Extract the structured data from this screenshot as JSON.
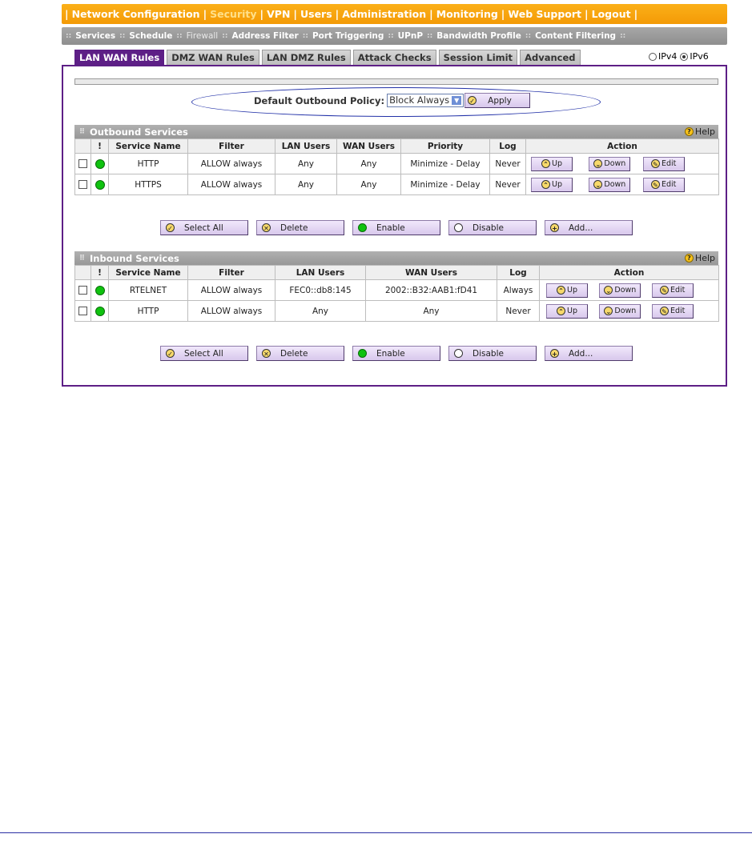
{
  "top_nav": {
    "items": [
      "Network Configuration",
      "Security",
      "VPN",
      "Users",
      "Administration",
      "Monitoring",
      "Web Support",
      "Logout"
    ],
    "active": "Security"
  },
  "sub_nav": {
    "items": [
      "Services",
      "Schedule",
      "Firewall",
      "Address Filter",
      "Port Triggering",
      "UPnP",
      "Bandwidth Profile",
      "Content Filtering"
    ],
    "active": "Firewall"
  },
  "tabs": [
    "LAN WAN Rules",
    "DMZ WAN Rules",
    "LAN DMZ Rules",
    "Attack Checks",
    "Session Limit",
    "Advanced"
  ],
  "active_tab": "LAN WAN Rules",
  "ip_version": {
    "ipv4": "IPv4",
    "ipv6": "IPv6",
    "selected": "IPv6"
  },
  "policy": {
    "label": "Default Outbound Policy:",
    "value": "Block Always",
    "apply": "Apply"
  },
  "outbound": {
    "title": "Outbound Services",
    "help": "Help",
    "columns": [
      "!",
      "Service Name",
      "Filter",
      "LAN Users",
      "WAN Users",
      "Priority",
      "Log",
      "Action"
    ],
    "rows": [
      {
        "service": "HTTP",
        "filter": "ALLOW always",
        "lan": "Any",
        "wan": "Any",
        "priority": "Minimize - Delay",
        "log": "Never"
      },
      {
        "service": "HTTPS",
        "filter": "ALLOW always",
        "lan": "Any",
        "wan": "Any",
        "priority": "Minimize - Delay",
        "log": "Never"
      }
    ]
  },
  "inbound": {
    "title": "Inbound Services",
    "help": "Help",
    "columns": [
      "!",
      "Service Name",
      "Filter",
      "LAN Users",
      "WAN Users",
      "Log",
      "Action"
    ],
    "rows": [
      {
        "service": "RTELNET",
        "filter": "ALLOW always",
        "lan": "FEC0::db8:145",
        "wan": "2002::B32:AAB1:fD41",
        "log": "Always"
      },
      {
        "service": "HTTP",
        "filter": "ALLOW always",
        "lan": "Any",
        "wan": "Any",
        "log": "Never"
      }
    ]
  },
  "action_buttons": {
    "up": "Up",
    "down": "Down",
    "edit": "Edit"
  },
  "bottom_buttons": {
    "select_all": "Select All",
    "delete": "Delete",
    "enable": "Enable",
    "disable": "Disable",
    "add": "Add..."
  },
  "colors": {
    "accent": "#5d1f86",
    "nav": "#f7a20b",
    "enabled": "#0fc20f"
  }
}
